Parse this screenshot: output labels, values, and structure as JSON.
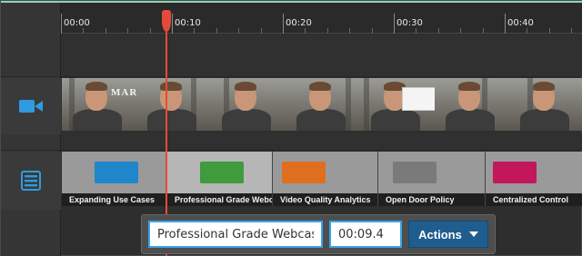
{
  "timeline": {
    "ruler_ticks": [
      "00:00",
      "00:10",
      "00:20",
      "00:30",
      "00:40"
    ],
    "playhead_time": "00:09.4"
  },
  "tracks": {
    "video_track_icon": "video-camera-icon",
    "slides_track_icon": "list-icon",
    "video_overlay_text": "MARK"
  },
  "slides": [
    {
      "label": "Expanding Use Cases",
      "thumb_color": "#1f86c9"
    },
    {
      "label": "Professional Grade Webcasting",
      "thumb_color": "#3f9b3c"
    },
    {
      "label": "Video Quality Analytics",
      "thumb_color": "#e06e1f"
    },
    {
      "label": "Open Door Policy",
      "thumb_color": "#7a7a7a"
    },
    {
      "label": "Centralized Control",
      "thumb_color": "#c2185b"
    }
  ],
  "editor": {
    "title_value": "Professional Grade Webcasti",
    "time_value": "00:09.4",
    "actions_label": "Actions"
  },
  "colors": {
    "accent": "#3aa3e8",
    "playhead": "#e24b3b",
    "actions_button": "#1f5d8f"
  }
}
